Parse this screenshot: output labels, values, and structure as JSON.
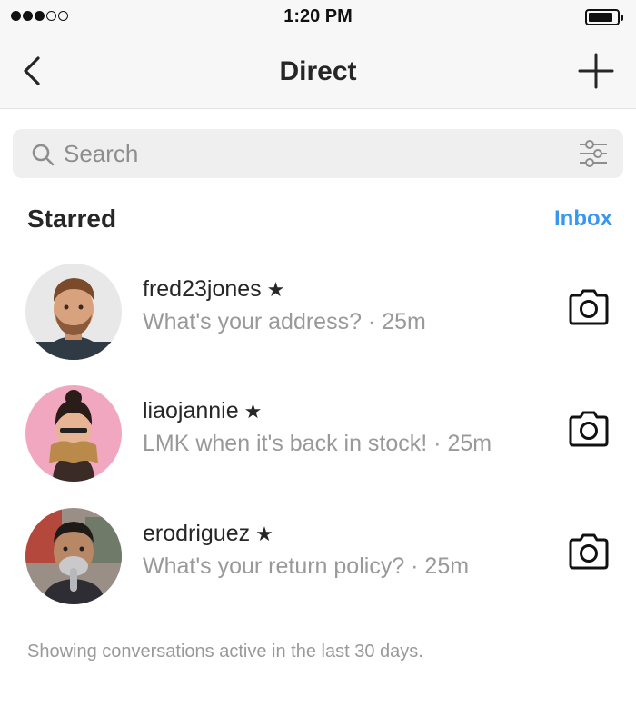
{
  "status_bar": {
    "time": "1:20 PM",
    "signal_bars_filled": 3,
    "signal_bars_total": 5,
    "battery_level": 0.85
  },
  "nav": {
    "title": "Direct",
    "back_icon": "chevron-left-icon",
    "new_icon": "plus-icon"
  },
  "search": {
    "placeholder": "Search",
    "value": "",
    "filter_icon": "sliders-icon"
  },
  "section": {
    "title": "Starred",
    "inbox_label": "Inbox"
  },
  "threads": [
    {
      "username": "fred23jones",
      "star": "★",
      "preview": "What's your address? · 25m"
    },
    {
      "username": "liaojannie",
      "star": "★",
      "preview": "LMK when it's back in stock! · 25m"
    },
    {
      "username": "erodriguez",
      "star": "★",
      "preview": "What's your return policy? · 25m"
    }
  ],
  "footer": {
    "note": "Showing conversations active in the last 30 days."
  },
  "colors": {
    "accent": "#3897f0",
    "text_primary": "#262626",
    "text_secondary": "#999999",
    "bar_background": "#f7f7f7",
    "search_background": "#efefef"
  }
}
